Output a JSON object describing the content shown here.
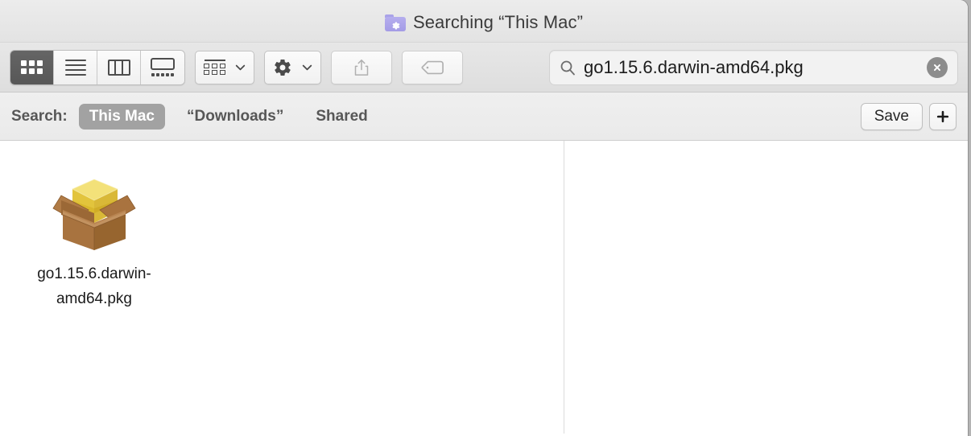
{
  "window": {
    "title": "Searching “This Mac”",
    "title_icon": "smart-folder-icon"
  },
  "toolbar": {
    "view_modes": [
      {
        "name": "icon-view",
        "icon": "grid-icon",
        "selected": true
      },
      {
        "name": "list-view",
        "icon": "list-icon",
        "selected": false
      },
      {
        "name": "column-view",
        "icon": "columns-icon",
        "selected": false
      },
      {
        "name": "gallery-view",
        "icon": "gallery-icon",
        "selected": false
      }
    ],
    "group_button": {
      "name": "arrange-button",
      "icon": "arrange-icon"
    },
    "action_button": {
      "name": "action-button",
      "icon": "gear-icon"
    },
    "share_button": {
      "name": "share-button",
      "icon": "share-icon",
      "disabled": true
    },
    "tags_button": {
      "name": "tags-button",
      "icon": "tag-icon",
      "disabled": true
    }
  },
  "search": {
    "icon": "magnifier-icon",
    "value": "go1.15.6.darwin-amd64.pkg",
    "placeholder": "Search",
    "clear_icon": "clear-circle-icon"
  },
  "scope_bar": {
    "label": "Search:",
    "items": [
      {
        "label": "This Mac",
        "selected": true
      },
      {
        "label": "“Downloads”",
        "selected": false
      },
      {
        "label": "Shared",
        "selected": false
      }
    ],
    "save_label": "Save",
    "add_icon": "plus-icon"
  },
  "content": {
    "files": [
      {
        "name": "go1.15.6.darwin-amd64.pkg",
        "icon": "package-installer-icon"
      }
    ]
  },
  "colors": {
    "titlebar": "#e7e7e7",
    "toolbar": "#e0e0e0",
    "scopebar": "#ededed",
    "selected_segment": "#5c5c5c",
    "selected_scope_pill": "#a2a2a2",
    "smart_folder": "#a9a2e8",
    "package_box": "#a9733f",
    "package_cube": "#e8c63a",
    "content_bg": "#ffffff"
  }
}
